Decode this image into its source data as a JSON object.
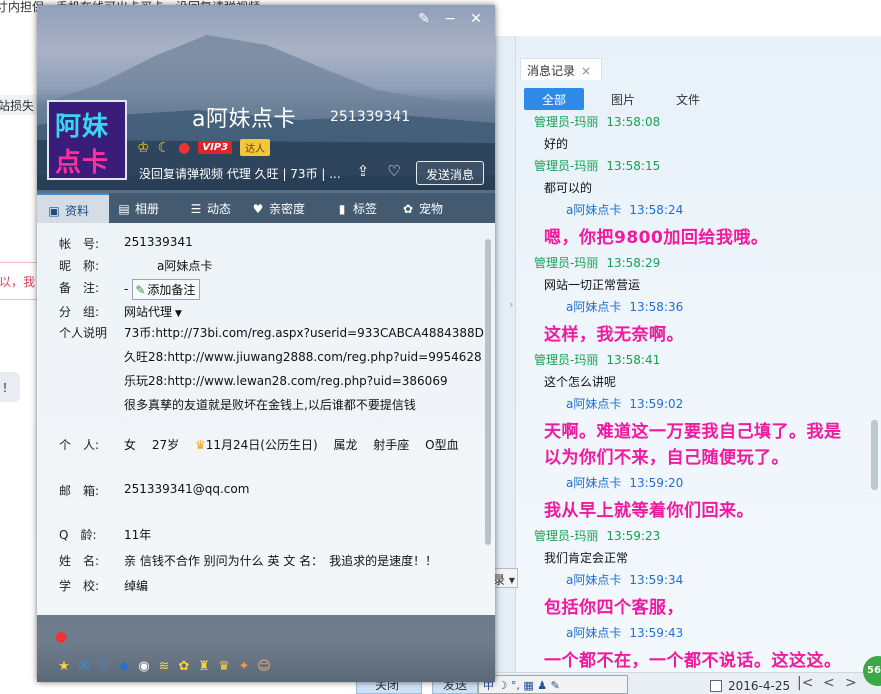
{
  "background": {
    "top_text": "寸内担保，手机在线可出卡买卡，没回复请弹视频",
    "left_frag1": "站损失",
    "left_frag2": "以，我",
    "left_frag3": "！"
  },
  "profile": {
    "avatar_line1": "阿妹",
    "avatar_line2": "点卡",
    "nickname": "a阿妹点卡",
    "qq_number": "251339341",
    "badges": {
      "vip": "VIP3",
      "daren": "达人"
    },
    "signature": "没回复请弹视频 代理 久旺 | 73币 | ...",
    "send_message": "发送消息",
    "window_controls": {
      "skin": "✎",
      "minimize": "−",
      "close": "✕"
    },
    "tabs": [
      {
        "label": "资料",
        "icon": "id-card-icon"
      },
      {
        "label": "相册",
        "icon": "photo-icon"
      },
      {
        "label": "动态",
        "icon": "feed-icon"
      },
      {
        "label": "亲密度",
        "icon": "heart-icon"
      },
      {
        "label": "标签",
        "icon": "bookmark-icon"
      },
      {
        "label": "宠物",
        "icon": "pet-icon"
      }
    ],
    "fields": {
      "account_label": "帐　号:",
      "account_value": "251339341",
      "nick_label": "昵　称:",
      "nick_value": "a阿妹点卡",
      "note_label": "备　注:",
      "note_value": "-",
      "note_button": "添加备注",
      "group_label": "分　组:",
      "group_value": "网站代理",
      "bio_label": "个人说明",
      "bio_lines": [
        "73币:http://73bi.com/reg.aspx?userid=933CABCA4884388D",
        "久旺28:http://www.jiuwang2888.com/reg.php?uid=9954628",
        "乐玩28:http://www.lewan28.com/reg.php?uid=386069",
        "很多真孳的友道就是败坏在金钱上,以后谁都不要提信钱"
      ],
      "person_label": "个　人:",
      "person_gender": "女",
      "person_age": "27岁",
      "person_birthday": "11月24日(公历生日)",
      "person_zodiac": "属龙",
      "person_sign": "射手座",
      "person_blood": "O型血",
      "email_label": "邮　箱:",
      "email_value": "251339341@qq.com",
      "qage_label": "Q　龄:",
      "qage_value": "11年",
      "name_label": "姓　名:",
      "name_value": "亲 信钱不合作 别问为什么 英 文 名：　我追求的是速度！！",
      "school_label": "学　校:",
      "school_value": "绰编"
    }
  },
  "chat": {
    "tab_title": "消息记录",
    "tab_close": "×",
    "filters": [
      "全部",
      "图片",
      "文件"
    ],
    "messages": [
      {
        "sender": "管理员-玛丽",
        "time": "13:58:08",
        "text": "好的",
        "role": "admin"
      },
      {
        "sender": "管理员-玛丽",
        "time": "13:58:15",
        "text": "都可以的",
        "role": "admin"
      },
      {
        "sender": "a阿妹点卡",
        "time": "13:58:24",
        "text": "嗯，你把9800加回给我哦。",
        "role": "user"
      },
      {
        "sender": "管理员-玛丽",
        "time": "13:58:29",
        "text": "网站一切正常营运",
        "role": "admin"
      },
      {
        "sender": "a阿妹点卡",
        "time": "13:58:36",
        "text": "这样，我无奈啊。",
        "role": "user"
      },
      {
        "sender": "管理员-玛丽",
        "time": "13:58:41",
        "text": "这个怎么讲呢",
        "role": "admin"
      },
      {
        "sender": "a阿妹点卡",
        "time": "13:59:02",
        "text": "天啊。难道这一万要我自己填了。我是以为你们不来，自己随便玩了。",
        "role": "user"
      },
      {
        "sender": "a阿妹点卡",
        "time": "13:59:20",
        "text": "我从早上就等着你们回来。",
        "role": "user"
      },
      {
        "sender": "管理员-玛丽",
        "time": "13:59:23",
        "text": "我们肯定会正常",
        "role": "admin"
      },
      {
        "sender": "a阿妹点卡",
        "time": "13:59:34",
        "text": "包括你四个客服，",
        "role": "user"
      },
      {
        "sender": "a阿妹点卡",
        "time": "13:59:43",
        "text": "一个都不在，一个都不说话。这这这。",
        "role": "user"
      }
    ],
    "date": "2016-4-25",
    "badge_number": "56"
  },
  "misc": {
    "ime_text": "中 ☽ °, ▦ ♟ ✎",
    "combo_frag": "录 ▾",
    "button_frag1": "关闭",
    "button_frag2": "发送"
  },
  "colors": {
    "admin_name": "#17a053",
    "user_name": "#1f6fd1",
    "user_text": "#f0199f",
    "accent": "#2d8ae6"
  }
}
